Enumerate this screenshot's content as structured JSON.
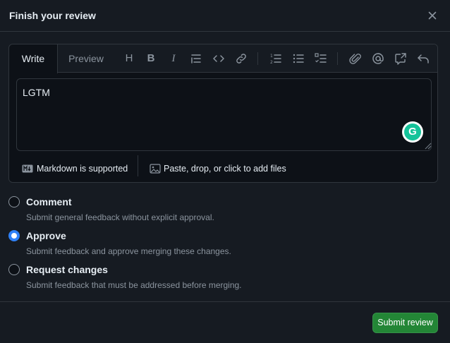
{
  "dialog": {
    "title": "Finish your review"
  },
  "editor": {
    "tabs": {
      "write": "Write",
      "preview": "Preview"
    },
    "toolbar_icons": [
      "heading-icon",
      "bold-icon",
      "italic-icon",
      "quote-icon",
      "code-icon",
      "link-icon",
      "ordered-list-icon",
      "unordered-list-icon",
      "task-list-icon",
      "attach-icon",
      "mention-icon",
      "cross-reference-icon",
      "undo-icon"
    ],
    "textarea_value": "LGTM",
    "markdown_label": "Markdown is supported",
    "attach_label": "Paste, drop, or click to add files"
  },
  "options": [
    {
      "label": "Comment",
      "description": "Submit general feedback without explicit approval.",
      "checked": false
    },
    {
      "label": "Approve",
      "description": "Submit feedback and approve merging these changes.",
      "checked": true
    },
    {
      "label": "Request changes",
      "description": "Submit feedback that must be addressed before merging.",
      "checked": false
    }
  ],
  "submit_label": "Submit review",
  "colors": {
    "accent": "#2f81f7",
    "primary_button": "#238636",
    "background": "#161b22",
    "border": "#30363d",
    "grammarly": "#15c39a"
  }
}
